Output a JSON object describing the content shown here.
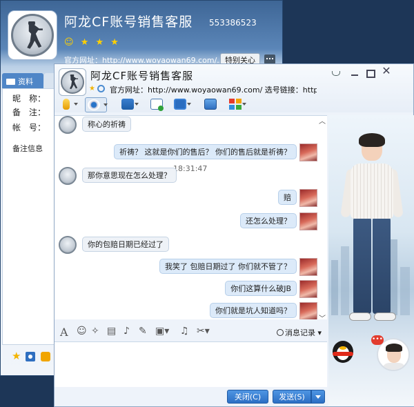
{
  "bg_window": {
    "title": "阿龙CF账号销售客服",
    "qq_number": "553386523",
    "stars": "★ ★ ★",
    "site": "官方网址：http://www.woyaowan69.com/...",
    "special_label": "特别关心",
    "tab_label": "资料",
    "fields": [
      "昵　称：",
      "备　注：",
      "帐　号："
    ],
    "remark_info": "备注信息"
  },
  "chat": {
    "title": "阿龙CF账号销售客服",
    "site": "官方网址：http://www.woyaowan69.com/ 选号链接：http:...",
    "time": "18:31:47",
    "messages": [
      {
        "side": "l",
        "text": "称心的祈祷"
      },
      {
        "side": "r",
        "text": "祈祷？ 这就是你们的售后？ 你们的售后就是祈祷？"
      },
      {
        "side": "l",
        "text": "那你意思现在怎么处理？"
      },
      {
        "side": "r",
        "text": "赔"
      },
      {
        "side": "r",
        "text": "还怎么处理？"
      },
      {
        "side": "l",
        "text": "你的包赔日期已经过了"
      },
      {
        "side": "r",
        "text": "我笑了 包赔日期过了 你们就不管了？"
      },
      {
        "side": "r",
        "text": "你们这算什么破JB"
      },
      {
        "side": "r",
        "text": "你们就是坑人知道吗？"
      }
    ],
    "msg_record": "消息记录",
    "close_label": "关闭(C)",
    "send_label": "发送(S)",
    "badge": "•••"
  },
  "colors": {
    "accent": "#2c6fc4",
    "bubble_right": "#dceaf9",
    "bubble_left": "#eef2f7"
  }
}
